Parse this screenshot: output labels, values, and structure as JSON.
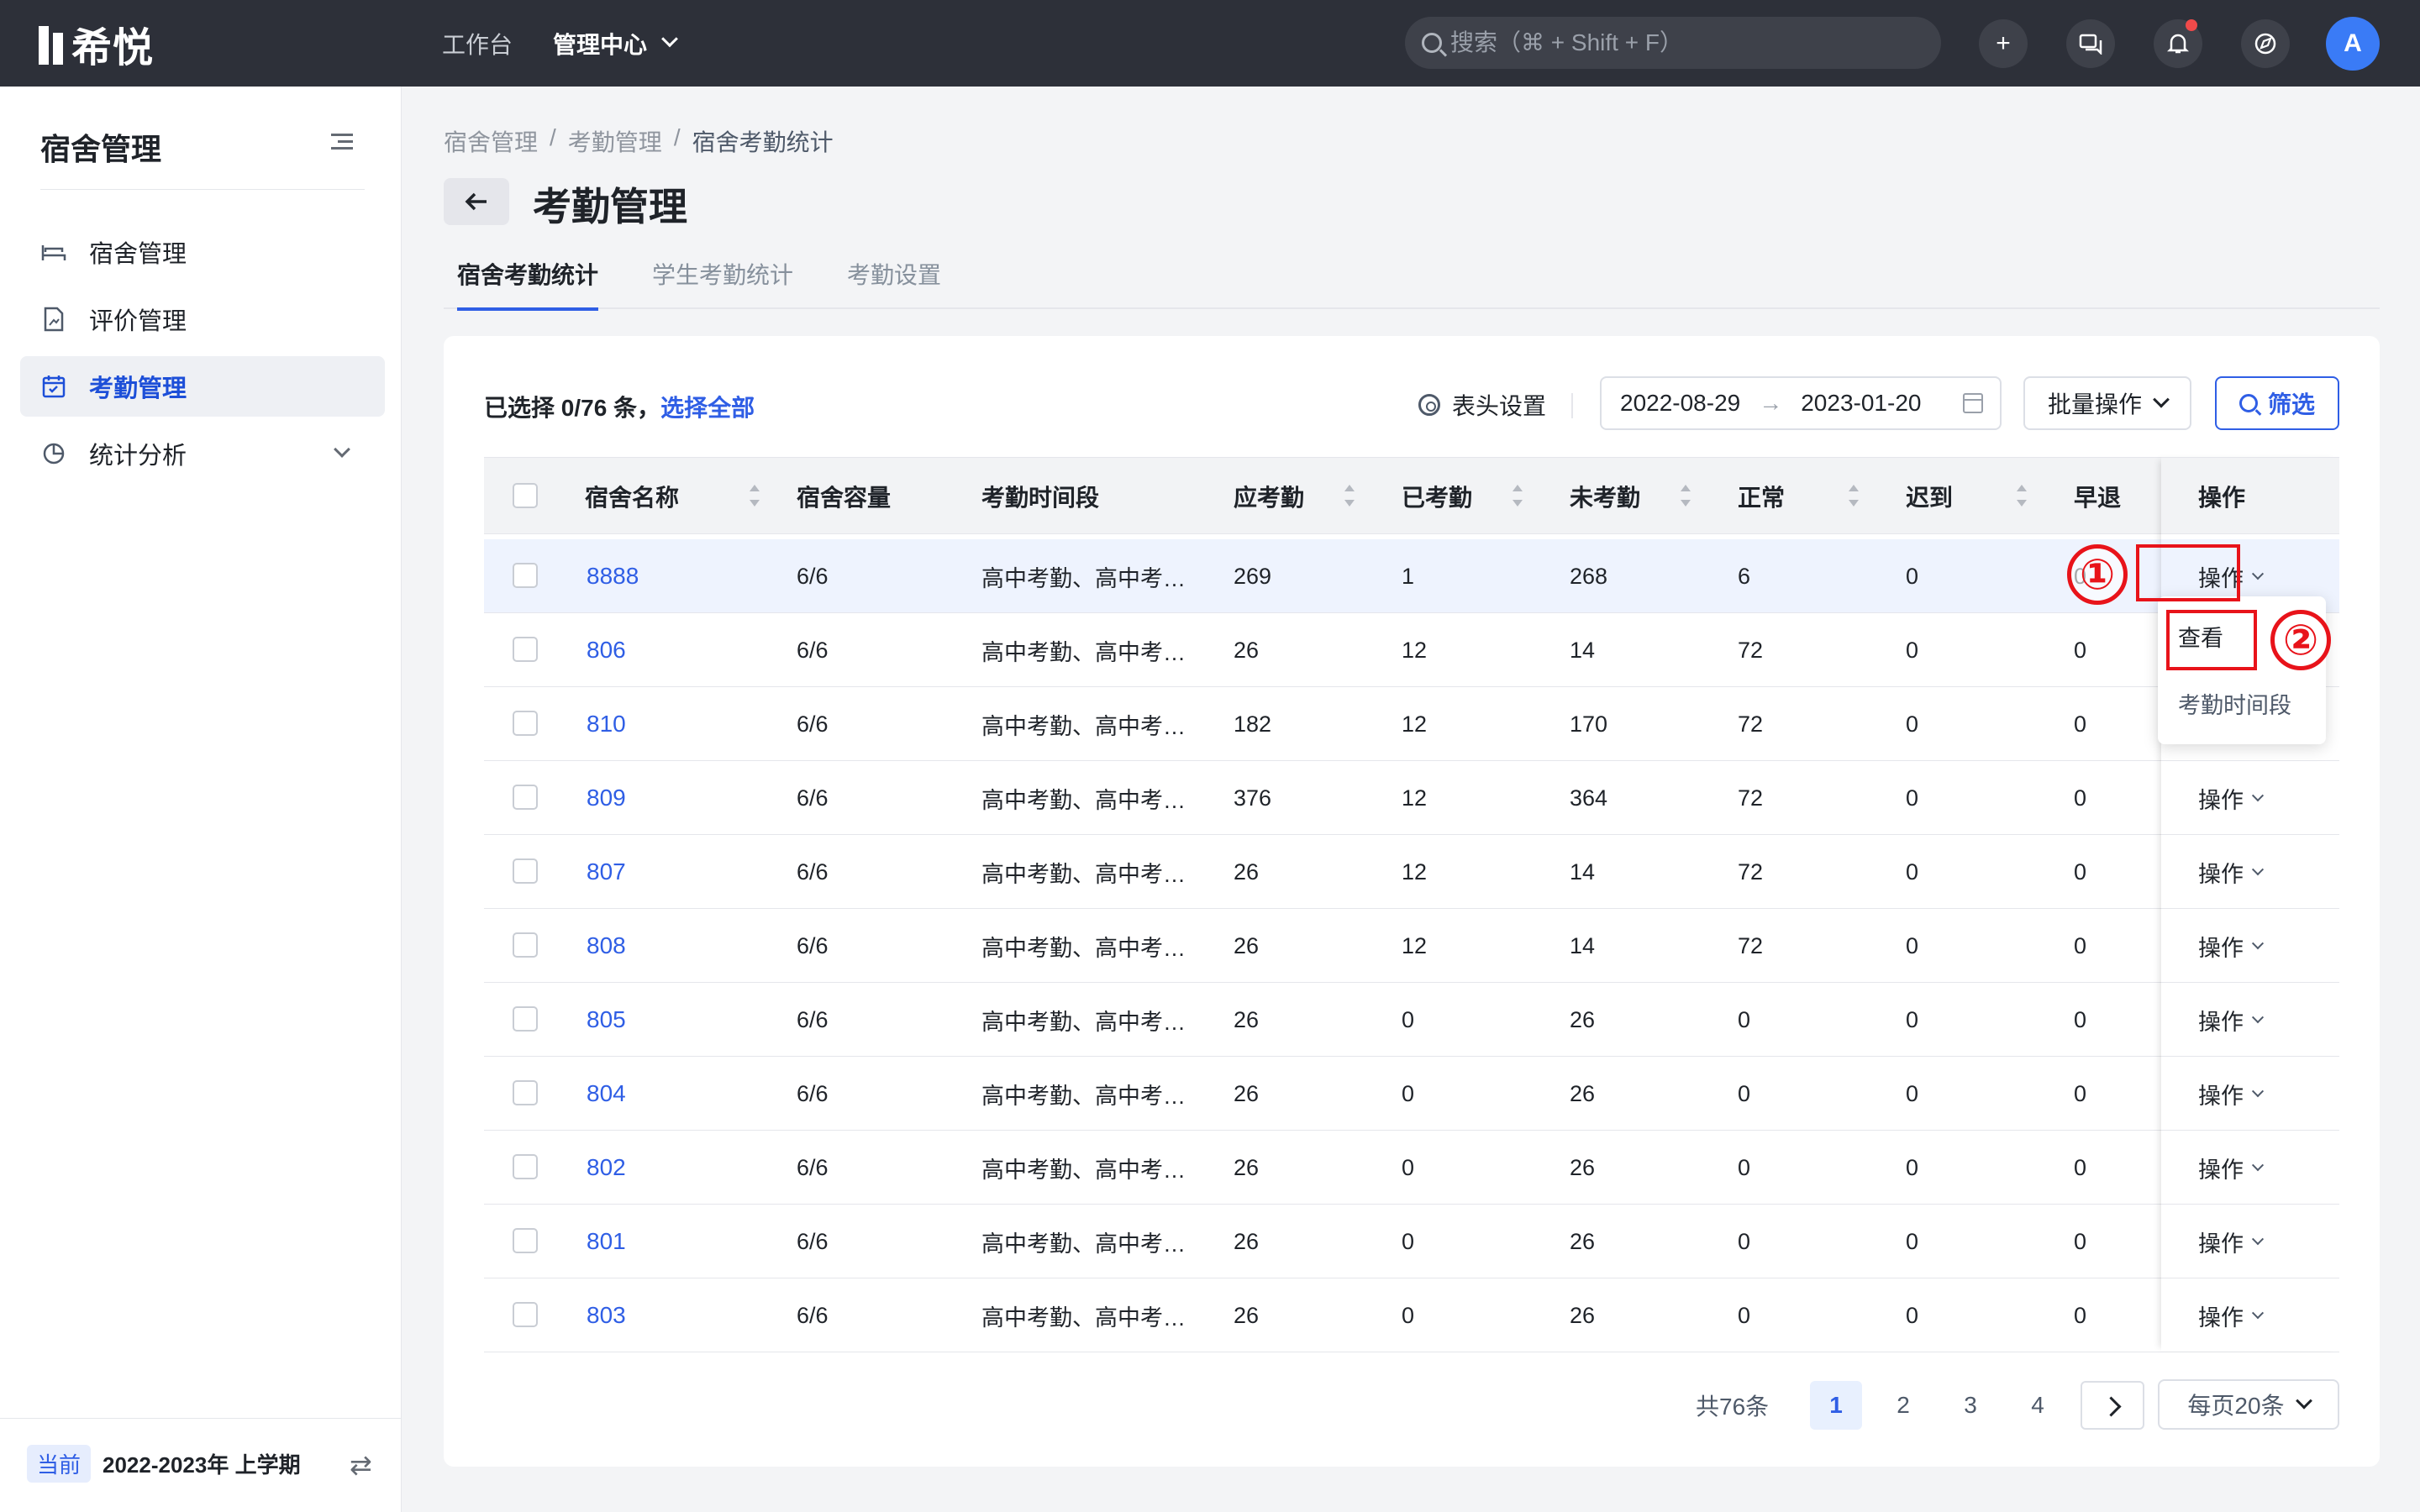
{
  "app": {
    "logo_text": "希悦",
    "nav": {
      "workbench": "工作台",
      "admin_center": "管理中心"
    },
    "search_placeholder": "搜索（⌘ + Shift + F）",
    "avatar_initial": "A",
    "accent": "#2f5ee5"
  },
  "sidebar": {
    "title": "宿舍管理",
    "items": [
      {
        "label": "宿舍管理",
        "icon": "bed-icon"
      },
      {
        "label": "评价管理",
        "icon": "document-chart-icon"
      },
      {
        "label": "考勤管理",
        "icon": "calendar-check-icon",
        "active": true
      },
      {
        "label": "统计分析",
        "icon": "pie-chart-icon"
      }
    ],
    "term_tag": "当前",
    "term": "2022-2023年 上学期"
  },
  "breadcrumb": [
    "宿舍管理",
    "/",
    "考勤管理",
    "/",
    "宿舍考勤统计"
  ],
  "page": {
    "title": "考勤管理",
    "tabs": [
      "宿舍考勤统计",
      "学生考勤统计",
      "考勤设置"
    ]
  },
  "toolbar": {
    "selected": "已选择 0/76 条，",
    "select_all": "选择全部",
    "header_settings": "表头设置",
    "date_start": "2022-08-29",
    "date_sep": "→",
    "date_end": "2023-01-20",
    "batch": "批量操作",
    "filter": "筛选"
  },
  "table": {
    "columns": [
      "宿舍名称",
      "宿舍容量",
      "考勤时间段",
      "应考勤",
      "已考勤",
      "未考勤",
      "正常",
      "迟到",
      "早退",
      "操作"
    ],
    "rows": [
      [
        "8888",
        "6/6",
        "高中考勤、高中考…",
        "269",
        "1",
        "268",
        "6",
        "0",
        "0",
        "操作"
      ],
      [
        "806",
        "6/6",
        "高中考勤、高中考…",
        "26",
        "12",
        "14",
        "72",
        "0",
        "0",
        "操作"
      ],
      [
        "810",
        "6/6",
        "高中考勤、高中考…",
        "182",
        "12",
        "170",
        "72",
        "0",
        "0",
        "操作"
      ],
      [
        "809",
        "6/6",
        "高中考勤、高中考…",
        "376",
        "12",
        "364",
        "72",
        "0",
        "0",
        "操作"
      ],
      [
        "807",
        "6/6",
        "高中考勤、高中考…",
        "26",
        "12",
        "14",
        "72",
        "0",
        "0",
        "操作"
      ],
      [
        "808",
        "6/6",
        "高中考勤、高中考…",
        "26",
        "12",
        "14",
        "72",
        "0",
        "0",
        "操作"
      ],
      [
        "805",
        "6/6",
        "高中考勤、高中考…",
        "26",
        "0",
        "26",
        "0",
        "0",
        "0",
        "操作"
      ],
      [
        "804",
        "6/6",
        "高中考勤、高中考…",
        "26",
        "0",
        "26",
        "0",
        "0",
        "0",
        "操作"
      ],
      [
        "802",
        "6/6",
        "高中考勤、高中考…",
        "26",
        "0",
        "26",
        "0",
        "0",
        "0",
        "操作"
      ],
      [
        "801",
        "6/6",
        "高中考勤、高中考…",
        "26",
        "0",
        "26",
        "0",
        "0",
        "0",
        "操作"
      ],
      [
        "803",
        "6/6",
        "高中考勤、高中考…",
        "26",
        "0",
        "26",
        "0",
        "0",
        "0",
        "操作"
      ]
    ]
  },
  "dropdown": {
    "items": [
      "查看",
      "考勤时间段"
    ]
  },
  "annotations": {
    "step1": "①",
    "step2": "②",
    "color": "#e8131a"
  },
  "pagination": {
    "total": "共76条",
    "pages": [
      "1",
      "2",
      "3",
      "4"
    ],
    "current": "1",
    "page_size": "每页20条"
  }
}
